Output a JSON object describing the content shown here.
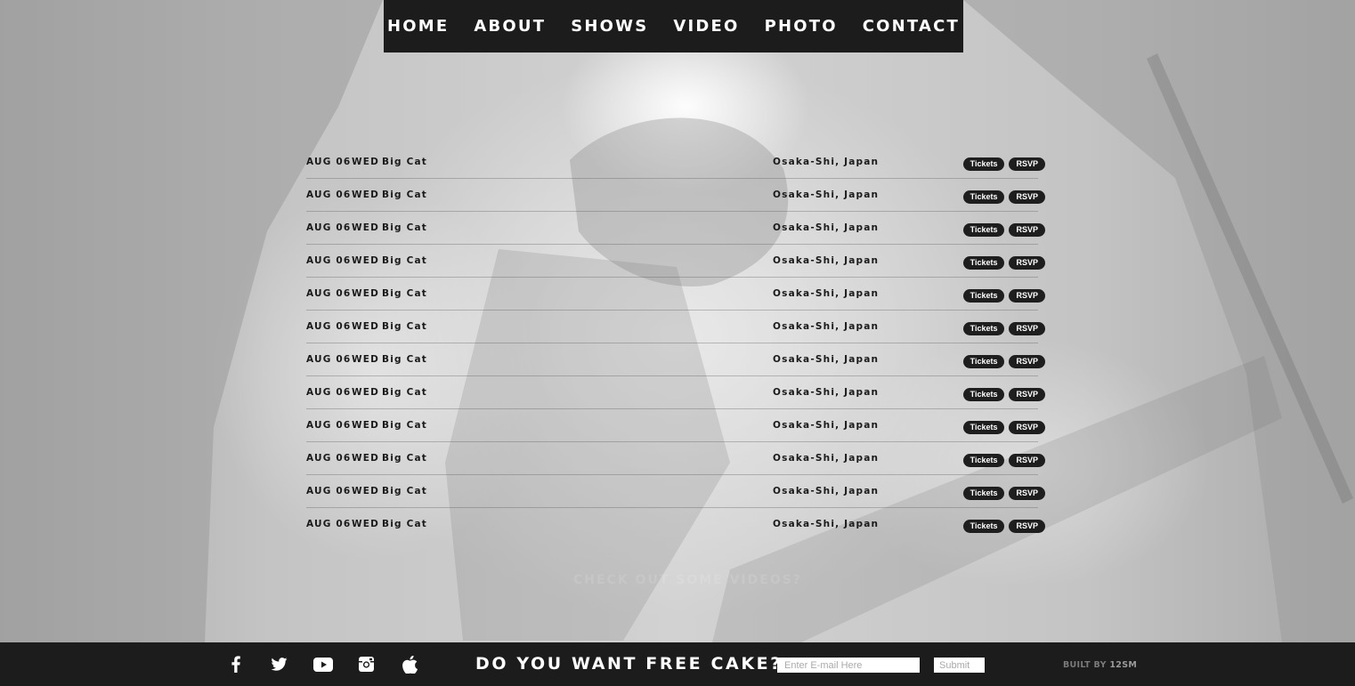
{
  "nav": {
    "items": [
      {
        "label": "HOME"
      },
      {
        "label": "ABOUT"
      },
      {
        "label": "SHOWS"
      },
      {
        "label": "VIDEO"
      },
      {
        "label": "PHOTO"
      },
      {
        "label": "CONTACT"
      }
    ]
  },
  "shows": [
    {
      "date": "AUG 06",
      "day": "WED",
      "venue": "Big Cat",
      "city": "Osaka-Shi, Japan",
      "tickets": "Tickets",
      "rsvp": "RSVP"
    },
    {
      "date": "AUG 06",
      "day": "WED",
      "venue": "Big Cat",
      "city": "Osaka-Shi, Japan",
      "tickets": "Tickets",
      "rsvp": "RSVP"
    },
    {
      "date": "AUG 06",
      "day": "WED",
      "venue": "Big Cat",
      "city": "Osaka-Shi, Japan",
      "tickets": "Tickets",
      "rsvp": "RSVP"
    },
    {
      "date": "AUG 06",
      "day": "WED",
      "venue": "Big Cat",
      "city": "Osaka-Shi, Japan",
      "tickets": "Tickets",
      "rsvp": "RSVP"
    },
    {
      "date": "AUG 06",
      "day": "WED",
      "venue": "Big Cat",
      "city": "Osaka-Shi, Japan",
      "tickets": "Tickets",
      "rsvp": "RSVP"
    },
    {
      "date": "AUG 06",
      "day": "WED",
      "venue": "Big Cat",
      "city": "Osaka-Shi, Japan",
      "tickets": "Tickets",
      "rsvp": "RSVP"
    },
    {
      "date": "AUG 06",
      "day": "WED",
      "venue": "Big Cat",
      "city": "Osaka-Shi, Japan",
      "tickets": "Tickets",
      "rsvp": "RSVP"
    },
    {
      "date": "AUG 06",
      "day": "WED",
      "venue": "Big Cat",
      "city": "Osaka-Shi, Japan",
      "tickets": "Tickets",
      "rsvp": "RSVP"
    },
    {
      "date": "AUG 06",
      "day": "WED",
      "venue": "Big Cat",
      "city": "Osaka-Shi, Japan",
      "tickets": "Tickets",
      "rsvp": "RSVP"
    },
    {
      "date": "AUG 06",
      "day": "WED",
      "venue": "Big Cat",
      "city": "Osaka-Shi, Japan",
      "tickets": "Tickets",
      "rsvp": "RSVP"
    },
    {
      "date": "AUG 06",
      "day": "WED",
      "venue": "Big Cat",
      "city": "Osaka-Shi, Japan",
      "tickets": "Tickets",
      "rsvp": "RSVP"
    },
    {
      "date": "AUG 06",
      "day": "WED",
      "venue": "Big Cat",
      "city": "Osaka-Shi, Japan",
      "tickets": "Tickets",
      "rsvp": "RSVP"
    }
  ],
  "videos_link": "CHECK OUT SOME VIDEOS?",
  "footer": {
    "social": [
      {
        "icon": "facebook-icon"
      },
      {
        "icon": "twitter-icon"
      },
      {
        "icon": "youtube-icon"
      },
      {
        "icon": "instagram-icon"
      },
      {
        "icon": "apple-icon"
      }
    ],
    "headline": "DO YOU WANT FREE CAKE?",
    "email_placeholder": "Enter E-mail Here",
    "submit_label": "Submit",
    "built_by_prefix": "BUILT BY",
    "built_by_name": "12SM"
  },
  "colors": {
    "bar": "#1c1c1c",
    "pill": "#1e1e1e",
    "text": "#1a1a1a"
  }
}
